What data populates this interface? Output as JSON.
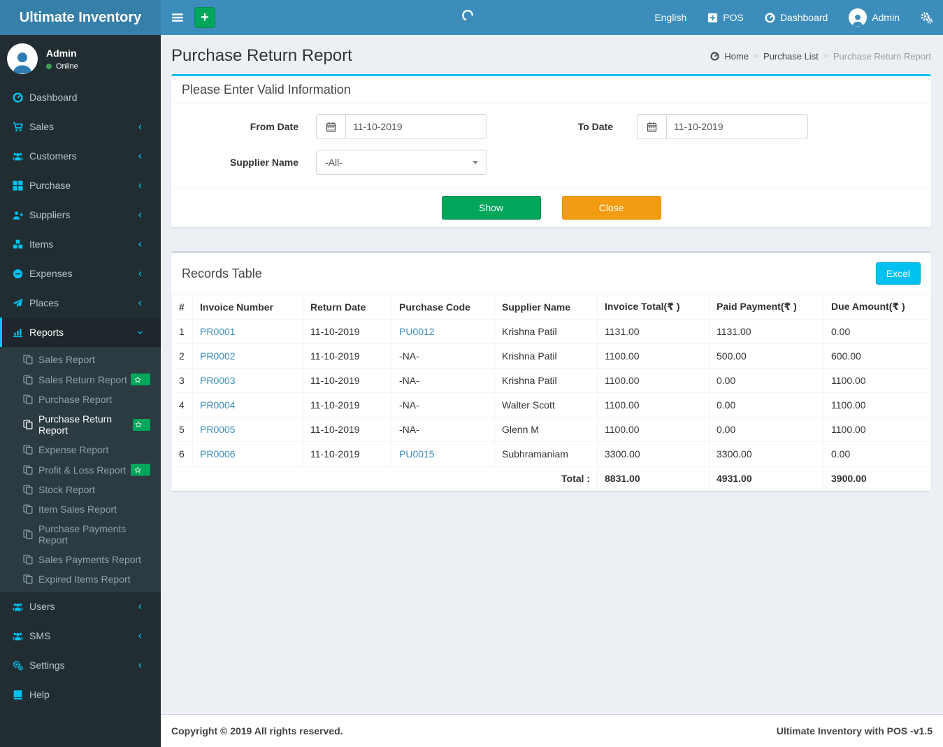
{
  "navbar": {
    "brand": "Ultimate Inventory",
    "add_button": "+",
    "language": "English",
    "pos": "POS",
    "dashboard": "Dashboard",
    "user": "Admin"
  },
  "sidebar": {
    "user": {
      "name": "Admin",
      "status": "Online"
    },
    "menu": [
      {
        "label": "Dashboard",
        "icon": "gauge"
      },
      {
        "label": "Sales",
        "icon": "cart",
        "chevron": "left"
      },
      {
        "label": "Customers",
        "icon": "users",
        "chevron": "left"
      },
      {
        "label": "Purchase",
        "icon": "grid",
        "chevron": "left"
      },
      {
        "label": "Suppliers",
        "icon": "user-plus",
        "chevron": "left"
      },
      {
        "label": "Items",
        "icon": "cubes",
        "chevron": "left"
      },
      {
        "label": "Expenses",
        "icon": "minus-circle",
        "chevron": "left"
      },
      {
        "label": "Places",
        "icon": "plane",
        "chevron": "left"
      },
      {
        "label": "Reports",
        "icon": "chart",
        "chevron": "down",
        "active": true,
        "children": [
          {
            "label": "Sales Report"
          },
          {
            "label": "Sales Return Report",
            "badge": "star"
          },
          {
            "label": "Purchase Report"
          },
          {
            "label": "Purchase Return Report",
            "badge": "star",
            "active": true
          },
          {
            "label": "Expense Report"
          },
          {
            "label": "Profit & Loss Report",
            "badge": "star"
          },
          {
            "label": "Stock Report"
          },
          {
            "label": "Item Sales Report"
          },
          {
            "label": "Purchase Payments Report"
          },
          {
            "label": "Sales Payments Report"
          },
          {
            "label": "Expired Items Report"
          }
        ]
      },
      {
        "label": "Users",
        "icon": "users",
        "chevron": "left"
      },
      {
        "label": "SMS",
        "icon": "users",
        "chevron": "left"
      },
      {
        "label": "Settings",
        "icon": "cogs",
        "chevron": "left"
      },
      {
        "label": "Help",
        "icon": "book"
      }
    ]
  },
  "page": {
    "title": "Purchase Return Report",
    "breadcrumb": {
      "0": "Home",
      "1": "Purchase List",
      "2": "Purchase Return Report"
    }
  },
  "filter": {
    "heading": "Please Enter Valid Information",
    "from_date": {
      "label": "From Date",
      "value": "11-10-2019"
    },
    "to_date": {
      "label": "To Date",
      "value": "11-10-2019"
    },
    "supplier": {
      "label": "Supplier Name",
      "value": "-All-"
    },
    "show_label": "Show",
    "close_label": "Close"
  },
  "records": {
    "heading": "Records Table",
    "excel_label": "Excel",
    "columns": [
      "#",
      "Invoice Number",
      "Return Date",
      "Purchase Code",
      "Supplier Name",
      "Invoice Total(₹ )",
      "Paid Payment(₹ )",
      "Due Amount(₹ )"
    ],
    "rows": [
      {
        "sl": "1",
        "invoice": "PR0001",
        "return_date": "11-10-2019",
        "purchase_code": "PU0012",
        "purchase_code_link": true,
        "supplier": "Krishna Patil",
        "invoice_total": "1131.00",
        "paid": "1131.00",
        "due": "0.00"
      },
      {
        "sl": "2",
        "invoice": "PR0002",
        "return_date": "11-10-2019",
        "purchase_code": "-NA-",
        "purchase_code_link": false,
        "supplier": "Krishna Patil",
        "invoice_total": "1100.00",
        "paid": "500.00",
        "due": "600.00"
      },
      {
        "sl": "3",
        "invoice": "PR0003",
        "return_date": "11-10-2019",
        "purchase_code": "-NA-",
        "purchase_code_link": false,
        "supplier": "Krishna Patil",
        "invoice_total": "1100.00",
        "paid": "0.00",
        "due": "1100.00"
      },
      {
        "sl": "4",
        "invoice": "PR0004",
        "return_date": "11-10-2019",
        "purchase_code": "-NA-",
        "purchase_code_link": false,
        "supplier": "Walter Scott",
        "invoice_total": "1100.00",
        "paid": "0.00",
        "due": "1100.00"
      },
      {
        "sl": "5",
        "invoice": "PR0005",
        "return_date": "11-10-2019",
        "purchase_code": "-NA-",
        "purchase_code_link": false,
        "supplier": "Glenn M",
        "invoice_total": "1100.00",
        "paid": "0.00",
        "due": "1100.00"
      },
      {
        "sl": "6",
        "invoice": "PR0006",
        "return_date": "11-10-2019",
        "purchase_code": "PU0015",
        "purchase_code_link": true,
        "supplier": "Subhramaniam",
        "invoice_total": "3300.00",
        "paid": "3300.00",
        "due": "0.00"
      }
    ],
    "total_label": "Total :",
    "totals": [
      "8831.00",
      "4931.00",
      "3900.00"
    ]
  },
  "footer": {
    "left": "Copyright © 2019 All rights reserved.",
    "right": "Ultimate Inventory with POS -v1.5"
  },
  "colors": {
    "navbar": "#3c8dbc",
    "logo": "#367fa9",
    "sidebar": "#222d32",
    "sidebar_submenu": "#2c3b41",
    "sidebar_icon": "#00c0ef",
    "accent": "#00c0ef",
    "green": "#00a65a",
    "orange": "#f39c12",
    "link": "#3c8dbc",
    "content_bg": "#ecf0f5",
    "border": "#d2d6de"
  }
}
